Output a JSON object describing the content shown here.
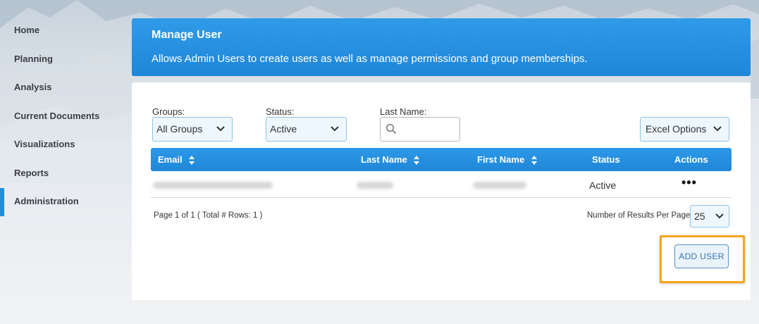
{
  "sidebar": {
    "items": [
      {
        "label": "Home"
      },
      {
        "label": "Planning"
      },
      {
        "label": "Analysis"
      },
      {
        "label": "Current Documents"
      },
      {
        "label": "Visualizations"
      },
      {
        "label": "Reports"
      },
      {
        "label": "Administration",
        "active": true
      }
    ]
  },
  "header": {
    "title": "Manage User",
    "description": "Allows Admin Users to create users as well as manage permissions and group memberships."
  },
  "filters": {
    "groups_label": "Groups:",
    "groups_value": "All Groups",
    "status_label": "Status:",
    "status_value": "Active",
    "lastname_label": "Last Name:",
    "lastname_value": "",
    "excel_options": "Excel Options"
  },
  "table": {
    "columns": [
      "Email",
      "Last Name",
      "First Name",
      "Status",
      "Actions"
    ],
    "rows": [
      {
        "status": "Active",
        "actions": "•••"
      }
    ]
  },
  "pagination": {
    "page_info": "Page 1 of 1 ( Total # Rows: 1 )",
    "per_page_label": "Number of Results Per Page",
    "per_page_value": "25"
  },
  "add_user_label": "ADD USER",
  "colors": {
    "accent": "#1f86d8",
    "highlight": "#f5a41c",
    "button_text": "#3575b5"
  },
  "icons": [
    "search-icon",
    "chevron-down-icon",
    "sort-icon",
    "more-icon"
  ]
}
